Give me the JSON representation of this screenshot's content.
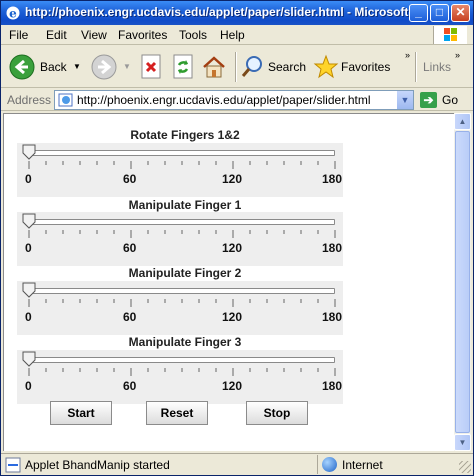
{
  "window": {
    "title": "http://phoenix.engr.ucdavis.edu/applet/paper/slider.html - Microsoft I..."
  },
  "menu": [
    "File",
    "Edit",
    "View",
    "Favorites",
    "Tools",
    "Help"
  ],
  "toolbar": {
    "back_label": "Back",
    "search_label": "Search",
    "favorites_label": "Favorites",
    "links_label": "Links"
  },
  "address": {
    "label": "Address",
    "url": "http://phoenix.engr.ucdavis.edu/applet/paper/slider.html",
    "go_label": "Go"
  },
  "sliders": [
    {
      "title": "Rotate Fingers 1&2",
      "value": 0,
      "min": 0,
      "max": 180,
      "labels": [
        "0",
        "60",
        "120",
        "180"
      ]
    },
    {
      "title": "Manipulate Finger 1",
      "value": 0,
      "min": 0,
      "max": 180,
      "labels": [
        "0",
        "60",
        "120",
        "180"
      ]
    },
    {
      "title": "Manipulate Finger 2",
      "value": 0,
      "min": 0,
      "max": 180,
      "labels": [
        "0",
        "60",
        "120",
        "180"
      ]
    },
    {
      "title": "Manipulate Finger 3",
      "value": 0,
      "min": 0,
      "max": 180,
      "labels": [
        "0",
        "60",
        "120",
        "180"
      ]
    }
  ],
  "buttons": {
    "start": "Start",
    "reset": "Reset",
    "stop": "Stop"
  },
  "status": {
    "text": "Applet BhandManip started",
    "zone": "Internet"
  },
  "colors": {
    "titlebar": "#0f4bc9",
    "panel": "#eeeeee",
    "chrome": "#ece9d8"
  }
}
